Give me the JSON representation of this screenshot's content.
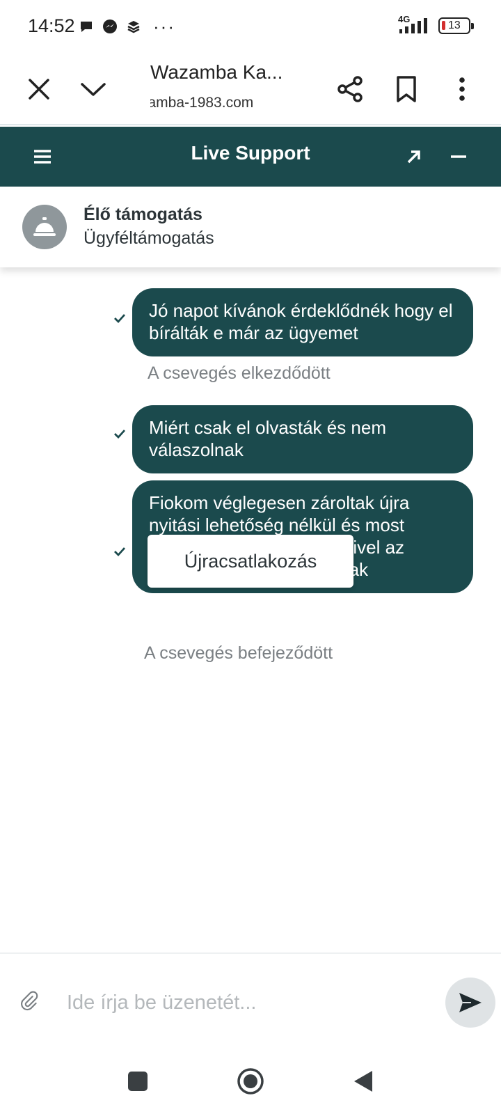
{
  "status_bar": {
    "time": "14:52",
    "more": "···",
    "network": "4G",
    "battery": "13"
  },
  "browser": {
    "title": "Wazamba Ka...",
    "url": "zamba-1983.com"
  },
  "chat_header": {
    "title": "Live Support"
  },
  "agent": {
    "name": "Élő támogatás",
    "role": "Ügyféltámogatás"
  },
  "messages": [
    {
      "text": "Jó napot kívánok érdeklődnék hogy el bírálták e már az ügyemet"
    },
    {
      "text": "Miért csak el olvasták és nem válaszolnak"
    },
    {
      "text": "Fiokom véglegesen zároltak újra nyitási lehetőség nélkül és most nélkül és a lrol küldtem mivel az enyem ről nem válaszolnak"
    }
  ],
  "system": {
    "started": "A csevegés elkezdődött",
    "ended": "A csevegés befejeződött"
  },
  "reconnect_label": "Újracsatlakozás",
  "composer": {
    "placeholder": "Ide írja be üzenetét..."
  },
  "colors": {
    "accent": "#1b4a4d",
    "system_text": "#7a7f83"
  }
}
